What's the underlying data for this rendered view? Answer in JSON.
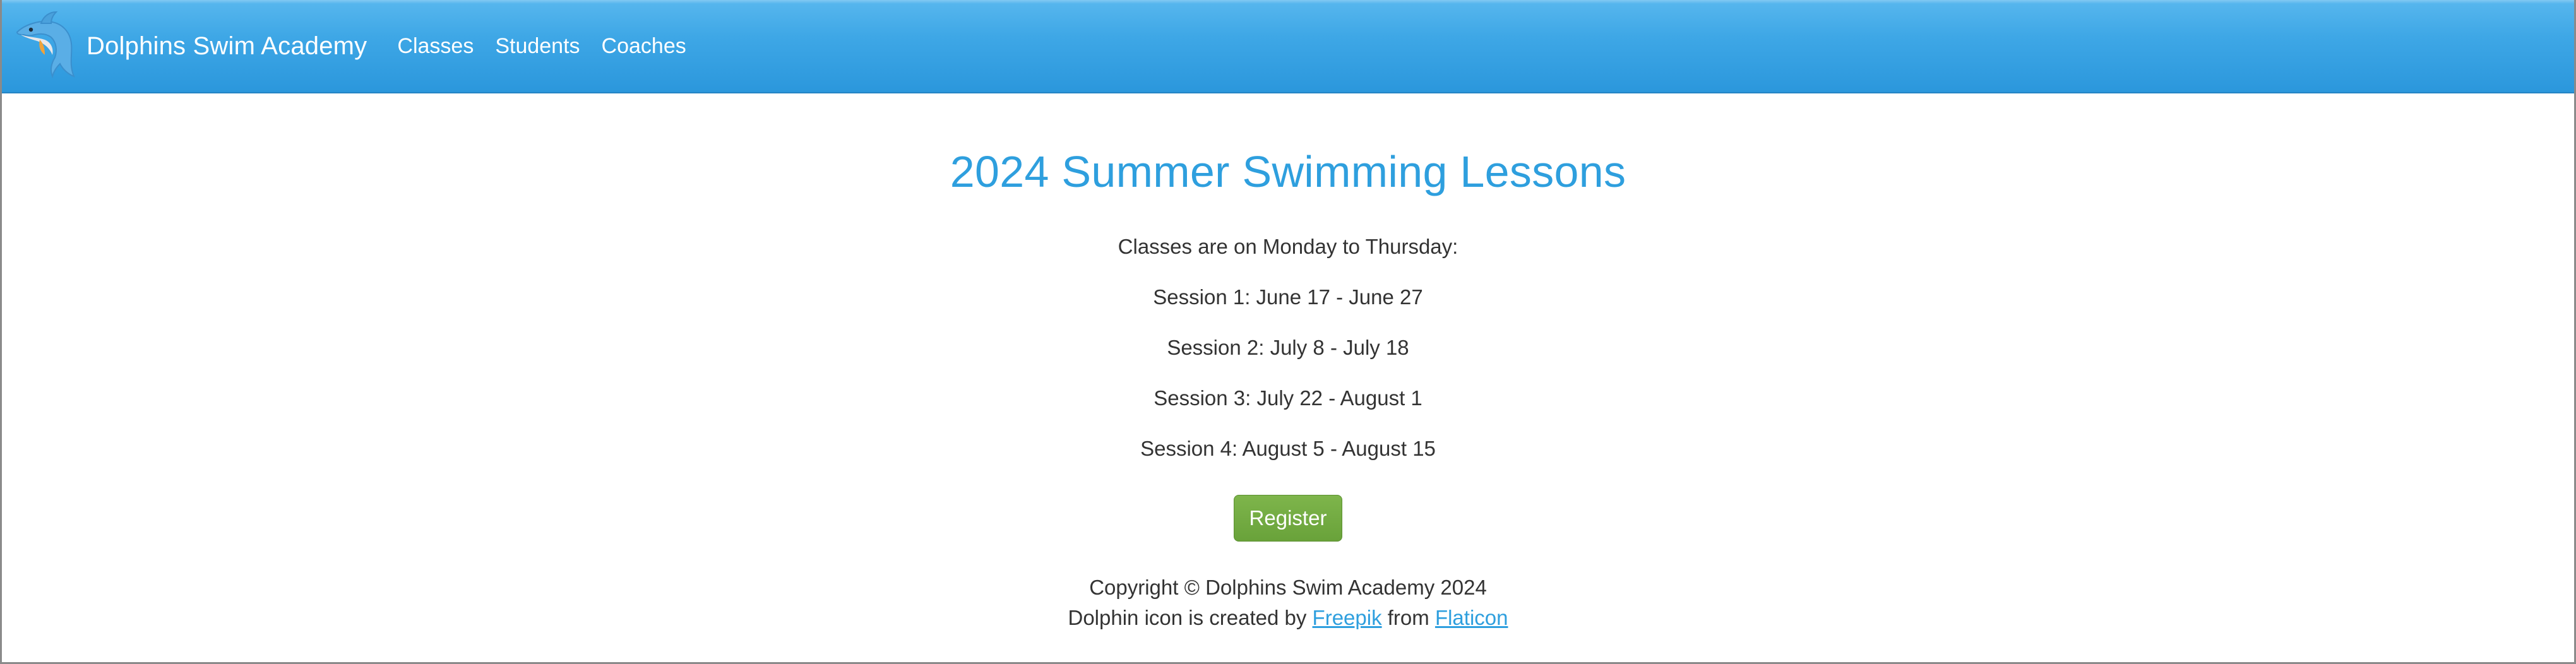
{
  "navbar": {
    "brand_logo_icon": "dolphin-icon",
    "brand_name": "Dolphins Swim Academy",
    "links": [
      {
        "label": "Classes"
      },
      {
        "label": "Students"
      },
      {
        "label": "Coaches"
      }
    ],
    "colors": {
      "bar": "#3ea7e6",
      "text": "#ffffff"
    }
  },
  "main": {
    "title": "2024 Summer Swimming Lessons",
    "schedule_intro": "Classes are on Monday to Thursday:",
    "sessions": [
      "Session 1: June 17 - June 27",
      "Session 2: July 8 - July 18",
      "Session 3: July 22 - August 1",
      "Session 4: August 5 - August 15"
    ],
    "register_label": "Register",
    "colors": {
      "title": "#2e9fde",
      "register_button": "#6fa83f"
    }
  },
  "footer": {
    "copyright": "Copyright © Dolphins Swim Academy 2024",
    "credit_prefix": "Dolphin icon is created by ",
    "credit_author": "Freepik",
    "credit_middle": " from ",
    "credit_source": "Flaticon"
  }
}
